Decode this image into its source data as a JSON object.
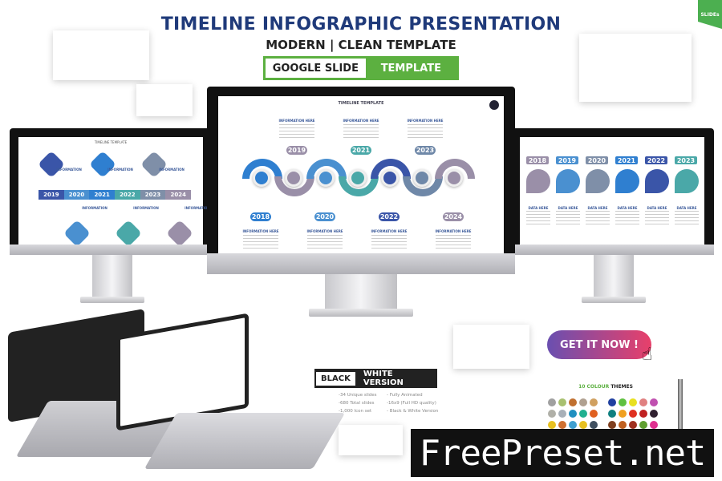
{
  "header": {
    "title": "TIMELINE INFOGRAPHIC PRESENTATION",
    "subtitle": "MODERN | CLEAN TEMPLATE",
    "google_slide": "GOOGLE SLIDE",
    "template": "TEMPLATE",
    "badge": "SLIDEs"
  },
  "center_slide": {
    "title": "TIMELINE TEMPLATE",
    "info": "INFORMATION HERE",
    "years_top": [
      "2019",
      "2021",
      "2023"
    ],
    "years_bottom": [
      "2018",
      "2020",
      "2022",
      "2024"
    ],
    "colors": [
      "#2f7fd0",
      "#9a8fa8",
      "#4a90d0",
      "#4aa8a8",
      "#3a55a8",
      "#6f88a8",
      "#9a8fa8"
    ]
  },
  "left_slide": {
    "title": "TIMELINE TEMPLATE",
    "info": "INFORMATION",
    "years": [
      "2019",
      "2020",
      "2021",
      "2022",
      "2023",
      "2024"
    ],
    "colors": [
      "#3a55a8",
      "#4a90d0",
      "#2f7fd0",
      "#4aa8a8",
      "#7f8fa8",
      "#9a8fa8"
    ]
  },
  "right_slide": {
    "years": [
      "2018",
      "2019",
      "2020",
      "2021",
      "2022",
      "2023"
    ],
    "info": "DATA HERE",
    "colors": [
      "#9a8fa8",
      "#4a90d0",
      "#7f8fa8",
      "#2f7fd0",
      "#3a55a8",
      "#4aa8a8"
    ]
  },
  "version": {
    "black": "BLACK",
    "white": "WHITE VERSION"
  },
  "features_left": [
    "-34 Unique slides",
    "-680 Total slides",
    "-1,000 Icon set"
  ],
  "features_right": [
    "- Fully Animated",
    "-16x9 (Full HD quality)",
    "- Black & White Version"
  ],
  "cta": "GET IT NOW !",
  "themes": {
    "count": "10",
    "colour": "COLOUR",
    "label": "THEMES",
    "left": [
      "#a0a0a0",
      "#a8c070",
      "#c07030",
      "#b0a090",
      "#d0a060",
      "#b0b0a8",
      "#a8b0b8",
      "#2090c0",
      "#20b090",
      "#e06020",
      "#e8c020",
      "#d07030",
      "#40a0d0",
      "#e8c020",
      "#405060"
    ],
    "right": [
      "#2040a0",
      "#60c040",
      "#e8e020",
      "#e08080",
      "#c050b0",
      "#108080",
      "#f0a020",
      "#e03020",
      "#c02020",
      "#302030",
      "#804020",
      "#c06020",
      "#a03020",
      "#60a030",
      "#e03090"
    ]
  },
  "watermark": "FreePreset.net"
}
